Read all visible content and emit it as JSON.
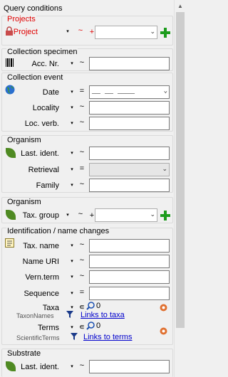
{
  "title": "Query conditions",
  "projects_section": {
    "title": "Projects",
    "label": "Project",
    "op_tilde": "~",
    "op_plus": "+"
  },
  "collection_specimen": {
    "title": "Collection specimen",
    "label": "Acc. Nr.",
    "op": "~"
  },
  "collection_event": {
    "title": "Collection event",
    "date_label": "Date",
    "date_op": "=",
    "date_value": "__ __  ____",
    "locality_label": "Locality",
    "locality_op": "~",
    "locverb_label": "Loc. verb.",
    "locverb_op": "~"
  },
  "organism1": {
    "title": "Organism",
    "lastident_label": "Last. ident.",
    "lastident_op": "~",
    "retrieval_label": "Retrieval",
    "retrieval_op": "=",
    "family_label": "Family",
    "family_op": "~"
  },
  "organism2": {
    "title": "Organism",
    "label": "Tax. group",
    "op_tilde": "~",
    "op_plus": "+"
  },
  "identification": {
    "title": "Identification / name changes",
    "taxname_label": "Tax. name",
    "taxname_op": "~",
    "nameuri_label": "Name URI",
    "nameuri_op": "~",
    "vernterm_label": "Vern.term",
    "vernterm_op": "~",
    "sequence_label": "Sequence",
    "sequence_op": "=",
    "taxa_label": "Taxa",
    "taxa_op": "∊",
    "taxa_count": "0",
    "taxonnames_label": "TaxonNames",
    "taxonnames_link": "Links to taxa",
    "terms_label": "Terms",
    "terms_op": "∊",
    "terms_count": "0",
    "scientificterms_label": "ScientificTerms",
    "scientificterms_link": "Links to terms"
  },
  "substrate": {
    "title": "Substrate",
    "label": "Last. ident.",
    "op": "~"
  },
  "icons": {
    "dropdown": "▾",
    "combo_arrow": "⌄"
  },
  "colors": {
    "projects_red": "#e00000",
    "plus_green": "#1d9c1d",
    "link_blue": "#0000cc"
  }
}
